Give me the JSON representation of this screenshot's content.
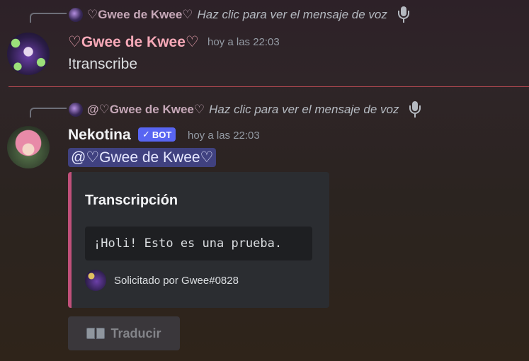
{
  "message1": {
    "reply": {
      "author": "♡Gwee de Kwee♡",
      "text": "Haz clic para ver el mensaje de voz"
    },
    "author": "♡Gwee de Kwee♡",
    "author_color": "#f7a9b8",
    "timestamp": "hoy a las 22:03",
    "content": "!transcribe"
  },
  "message2": {
    "reply": {
      "author": "@♡Gwee de Kwee♡",
      "text": "Haz clic para ver el mensaje de voz"
    },
    "author": "Nekotina",
    "author_color": "#f2f3f5",
    "bot_tag": "BOT",
    "timestamp": "hoy a las 22:03",
    "mention": "@♡Gwee de Kwee♡",
    "embed": {
      "title": "Transcripción",
      "code": "¡Holi! Esto es una prueba.",
      "footer": "Solicitado por Gwee#0828",
      "accent_color": "#c0507a"
    },
    "button": {
      "label": "Traducir",
      "icon": "book-icon"
    }
  },
  "colors": {
    "divider": "#b74a52",
    "bot_tag": "#5865f2"
  }
}
